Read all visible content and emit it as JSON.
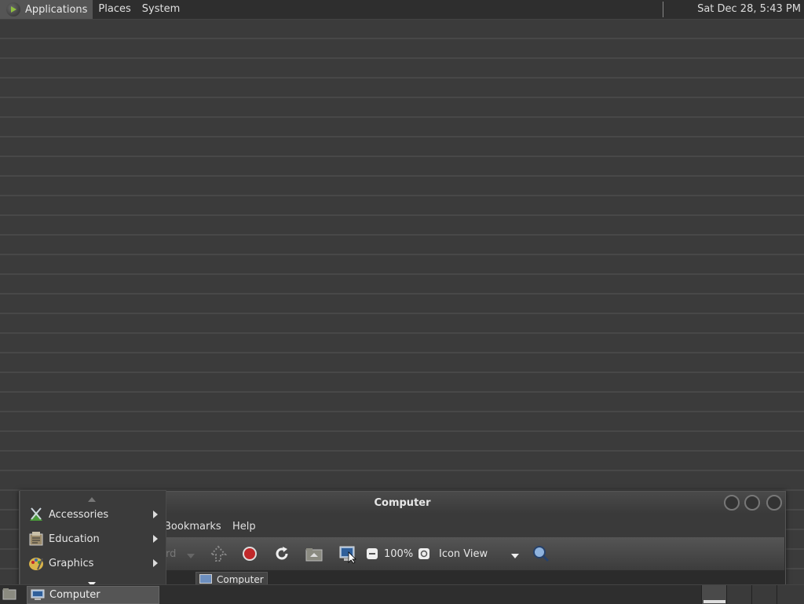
{
  "top_panel": {
    "menus": [
      "Applications",
      "Places",
      "System"
    ],
    "clock": "Sat Dec 28,  5:43 PM"
  },
  "window": {
    "title": "Computer",
    "menubar": {
      "bookmarks": "Bookmarks",
      "help": "Help"
    },
    "toolbar": {
      "forward_label": "rd",
      "zoom": "100%",
      "view_mode": "Icon View"
    },
    "location": "Computer"
  },
  "apps_menu": {
    "items": [
      {
        "label": "Accessories",
        "icon": "accessories-icon"
      },
      {
        "label": "Education",
        "icon": "education-icon"
      },
      {
        "label": "Graphics",
        "icon": "graphics-icon"
      }
    ]
  },
  "bottom_panel": {
    "task": "Computer"
  },
  "colors": {
    "panel": "#2e2e2e",
    "desktop": "#3b3b3b",
    "stop_red": "#c0282a"
  }
}
